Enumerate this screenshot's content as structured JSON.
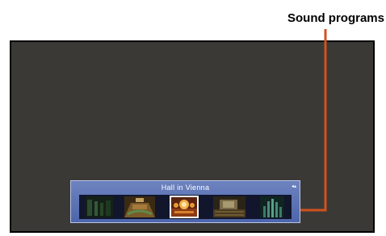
{
  "callout": {
    "label": "Sound programs",
    "line_color": "#d1521e"
  },
  "osd": {
    "program_name": "Hall in Vienna",
    "nav_arrows_icon": "left-up-arrows-icon",
    "background_color": "#5a71b3",
    "programs": [
      {
        "icon": "dim-hall-thumbnail-icon",
        "selected": false
      },
      {
        "icon": "auditorium-thumbnail-icon",
        "selected": false
      },
      {
        "icon": "chandelier-hall-thumbnail-icon",
        "selected": true
      },
      {
        "icon": "theater-stage-thumbnail-icon",
        "selected": false
      },
      {
        "icon": "organ-hall-thumbnail-icon",
        "selected": false
      }
    ]
  },
  "screen": {
    "background_color": "#3b3936"
  }
}
